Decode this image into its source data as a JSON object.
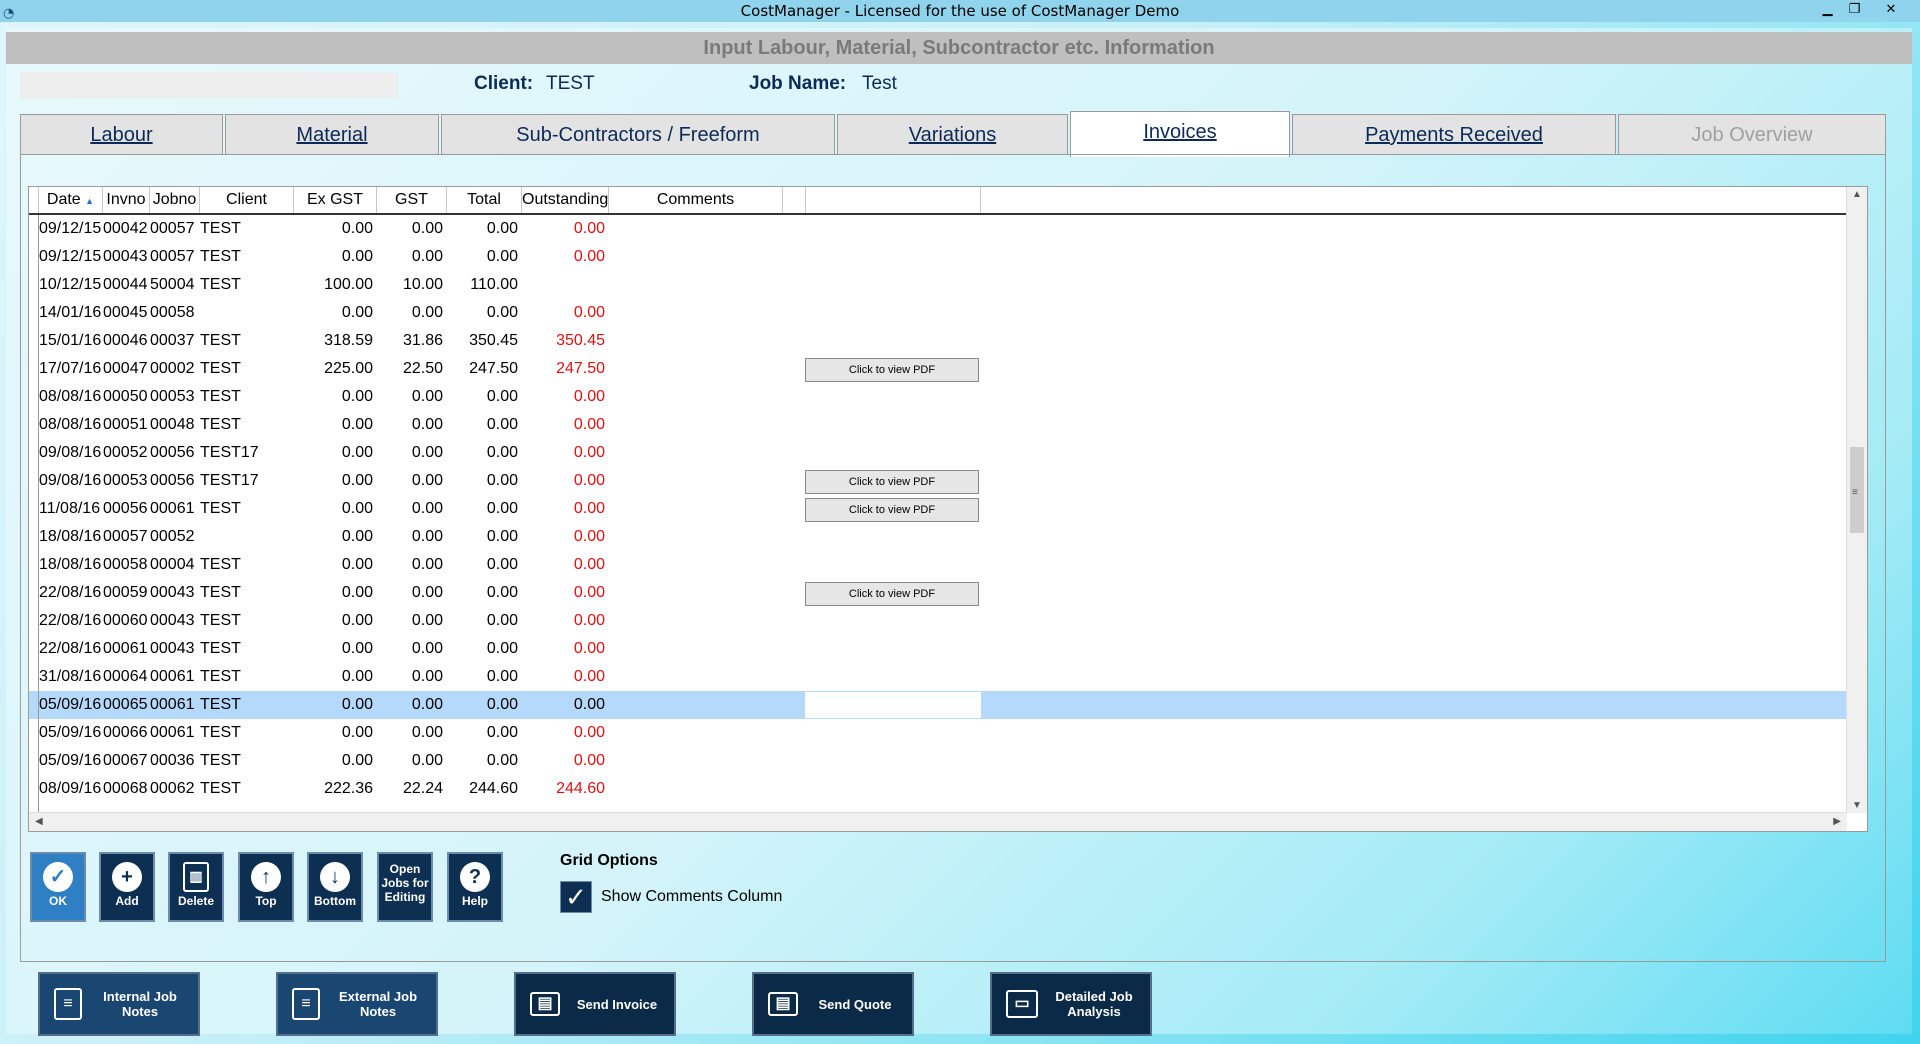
{
  "window": {
    "title": "CostManager - Licensed for the use of CostManager Demo"
  },
  "header": {
    "banner": "Input Labour, Material, Subcontractor etc.  Information",
    "client_label": "Client:",
    "client_value": "TEST",
    "jobname_label": "Job Name:",
    "jobname_value": "Test"
  },
  "tabs": [
    {
      "label": "Labour",
      "state": "normal"
    },
    {
      "label": "Material",
      "state": "normal"
    },
    {
      "label": "Sub-Contractors / Freeform",
      "state": "normal"
    },
    {
      "label": "Variations",
      "state": "normal"
    },
    {
      "label": "Invoices",
      "state": "active"
    },
    {
      "label": "Payments Received",
      "state": "normal"
    },
    {
      "label": "Job Overview",
      "state": "disabled"
    }
  ],
  "grid": {
    "columns": [
      "Date",
      "Invno",
      "Jobno",
      "Client",
      "Ex GST",
      "GST",
      "Total",
      "Outstanding",
      "Comments"
    ],
    "sort_glyph": "▲",
    "pdf_label": "Click to view PDF",
    "rows": [
      {
        "date": "09/12/15",
        "invno": "00042",
        "jobno": "00057",
        "client": "TEST",
        "exgst": "0.00",
        "gst": "0.00",
        "total": "0.00",
        "outstanding": "0.00",
        "red": true,
        "pdf": false
      },
      {
        "date": "09/12/15",
        "invno": "00043",
        "jobno": "00057",
        "client": "TEST",
        "exgst": "0.00",
        "gst": "0.00",
        "total": "0.00",
        "outstanding": "0.00",
        "red": true,
        "pdf": false
      },
      {
        "date": "10/12/15",
        "invno": "00044",
        "jobno": "50004",
        "client": "TEST",
        "exgst": "100.00",
        "gst": "10.00",
        "total": "110.00",
        "outstanding": "",
        "red": false,
        "pdf": false
      },
      {
        "date": "14/01/16",
        "invno": "00045",
        "jobno": "00058",
        "client": "",
        "exgst": "0.00",
        "gst": "0.00",
        "total": "0.00",
        "outstanding": "0.00",
        "red": true,
        "pdf": false
      },
      {
        "date": "15/01/16",
        "invno": "00046",
        "jobno": "00037",
        "client": "TEST",
        "exgst": "318.59",
        "gst": "31.86",
        "total": "350.45",
        "outstanding": "350.45",
        "red": true,
        "pdf": false
      },
      {
        "date": "17/07/16",
        "invno": "00047",
        "jobno": "00002",
        "client": "TEST",
        "exgst": "225.00",
        "gst": "22.50",
        "total": "247.50",
        "outstanding": "247.50",
        "red": true,
        "pdf": true
      },
      {
        "date": "08/08/16",
        "invno": "00050",
        "jobno": "00053",
        "client": "TEST",
        "exgst": "0.00",
        "gst": "0.00",
        "total": "0.00",
        "outstanding": "0.00",
        "red": true,
        "pdf": false
      },
      {
        "date": "08/08/16",
        "invno": "00051",
        "jobno": "00048",
        "client": "TEST",
        "exgst": "0.00",
        "gst": "0.00",
        "total": "0.00",
        "outstanding": "0.00",
        "red": true,
        "pdf": false
      },
      {
        "date": "09/08/16",
        "invno": "00052",
        "jobno": "00056",
        "client": "TEST17",
        "exgst": "0.00",
        "gst": "0.00",
        "total": "0.00",
        "outstanding": "0.00",
        "red": true,
        "pdf": false
      },
      {
        "date": "09/08/16",
        "invno": "00053",
        "jobno": "00056",
        "client": "TEST17",
        "exgst": "0.00",
        "gst": "0.00",
        "total": "0.00",
        "outstanding": "0.00",
        "red": true,
        "pdf": true
      },
      {
        "date": "11/08/16",
        "invno": "00056",
        "jobno": "00061",
        "client": "TEST",
        "exgst": "0.00",
        "gst": "0.00",
        "total": "0.00",
        "outstanding": "0.00",
        "red": true,
        "pdf": true
      },
      {
        "date": "18/08/16",
        "invno": "00057",
        "jobno": "00052",
        "client": "",
        "exgst": "0.00",
        "gst": "0.00",
        "total": "0.00",
        "outstanding": "0.00",
        "red": true,
        "pdf": false
      },
      {
        "date": "18/08/16",
        "invno": "00058",
        "jobno": "00004",
        "client": "TEST",
        "exgst": "0.00",
        "gst": "0.00",
        "total": "0.00",
        "outstanding": "0.00",
        "red": true,
        "pdf": false
      },
      {
        "date": "22/08/16",
        "invno": "00059",
        "jobno": "00043",
        "client": "TEST",
        "exgst": "0.00",
        "gst": "0.00",
        "total": "0.00",
        "outstanding": "0.00",
        "red": true,
        "pdf": true
      },
      {
        "date": "22/08/16",
        "invno": "00060",
        "jobno": "00043",
        "client": "TEST",
        "exgst": "0.00",
        "gst": "0.00",
        "total": "0.00",
        "outstanding": "0.00",
        "red": true,
        "pdf": false
      },
      {
        "date": "22/08/16",
        "invno": "00061",
        "jobno": "00043",
        "client": "TEST",
        "exgst": "0.00",
        "gst": "0.00",
        "total": "0.00",
        "outstanding": "0.00",
        "red": true,
        "pdf": false
      },
      {
        "date": "31/08/16",
        "invno": "00064",
        "jobno": "00061",
        "client": "TEST",
        "exgst": "0.00",
        "gst": "0.00",
        "total": "0.00",
        "outstanding": "0.00",
        "red": true,
        "pdf": false
      },
      {
        "date": "05/09/16",
        "invno": "00065",
        "jobno": "00061",
        "client": "TEST",
        "exgst": "0.00",
        "gst": "0.00",
        "total": "0.00",
        "outstanding": "0.00",
        "red": false,
        "pdf": false,
        "selected": true
      },
      {
        "date": "05/09/16",
        "invno": "00066",
        "jobno": "00061",
        "client": "TEST",
        "exgst": "0.00",
        "gst": "0.00",
        "total": "0.00",
        "outstanding": "0.00",
        "red": true,
        "pdf": false
      },
      {
        "date": "05/09/16",
        "invno": "00067",
        "jobno": "00036",
        "client": "TEST",
        "exgst": "0.00",
        "gst": "0.00",
        "total": "0.00",
        "outstanding": "0.00",
        "red": true,
        "pdf": false
      },
      {
        "date": "08/09/16",
        "invno": "00068",
        "jobno": "00062",
        "client": "TEST",
        "exgst": "222.36",
        "gst": "22.24",
        "total": "244.60",
        "outstanding": "244.60",
        "red": true,
        "pdf": false
      }
    ]
  },
  "toolbar": {
    "ok": "OK",
    "add": "Add",
    "delete": "Delete",
    "top": "Top",
    "bottom": "Bottom",
    "open_jobs_1": "Open",
    "open_jobs_2": "Jobs for",
    "open_jobs_3": "Editing",
    "help": "Help"
  },
  "grid_options": {
    "title": "Grid Options",
    "show_comments_label": "Show Comments Column",
    "show_comments_checked": true
  },
  "bottom_buttons": {
    "internal_notes": "Internal Job Notes",
    "external_notes": "External Job Notes",
    "send_invoice": "Send Invoice",
    "send_quote": "Send Quote",
    "detailed_1": "Detailed Job",
    "detailed_2": "Analysis"
  }
}
